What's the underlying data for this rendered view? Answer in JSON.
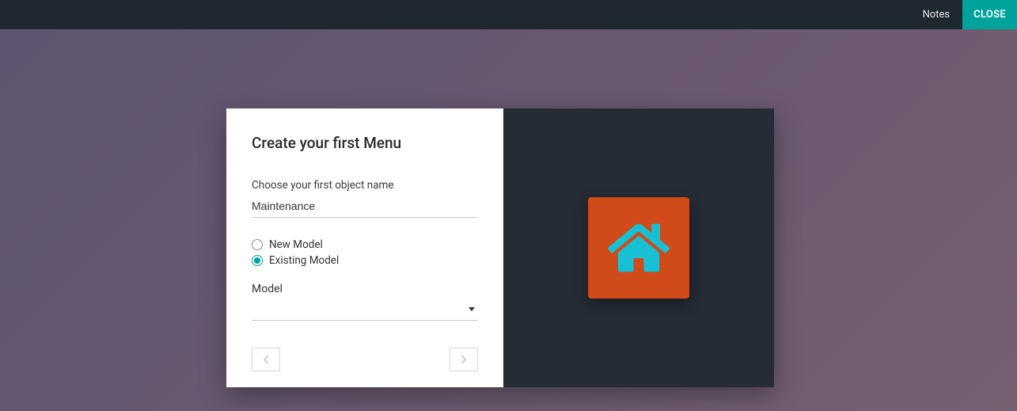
{
  "topbar": {
    "notes_label": "Notes",
    "close_label": "CLOSE"
  },
  "dialog": {
    "title": "Create your first Menu",
    "object_name_label": "Choose your first object name",
    "object_name_value": "Maintenance",
    "radio": {
      "new_model_label": "New Model",
      "existing_model_label": "Existing Model",
      "selected": "existing"
    },
    "model_field_label": "Model",
    "model_selected_value": ""
  },
  "preview": {
    "tile_color": "#d14a1a",
    "icon_name": "home-icon",
    "icon_color": "#17c1d3"
  }
}
